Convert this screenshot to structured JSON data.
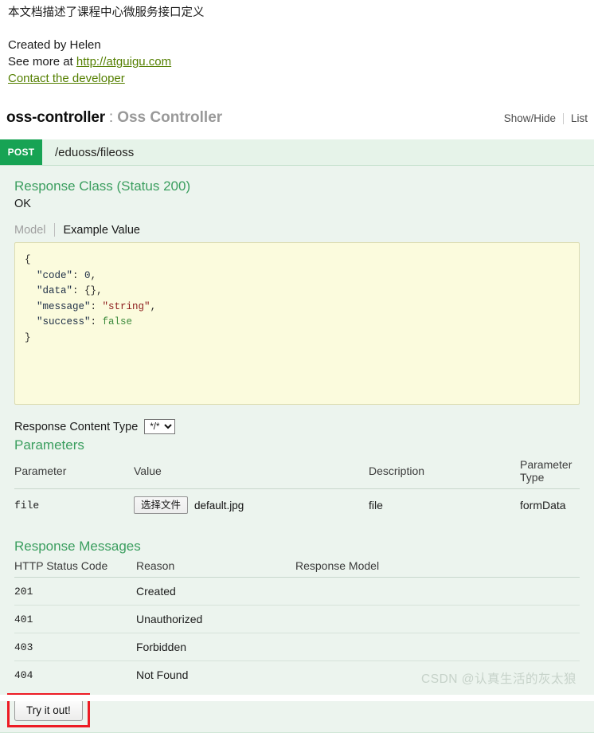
{
  "info": {
    "description": "本文档描述了课程中心微服务接口定义",
    "created_by": "Created by Helen",
    "see_more_prefix": "See more at ",
    "see_more_link": "http://atguigu.com",
    "contact_link": "Contact the developer"
  },
  "resource": {
    "name": "oss-controller",
    "separator": ":",
    "description": "Oss Controller",
    "show_hide": "Show/Hide",
    "list": "List"
  },
  "operation": {
    "method": "POST",
    "path": "/eduoss/fileoss"
  },
  "response_class": {
    "title": "Response Class (Status 200)",
    "status_text": "OK",
    "tab_model": "Model",
    "tab_example": "Example Value",
    "example_json": {
      "open_brace": "{",
      "lines": [
        {
          "key": "\"code\"",
          "value": "0",
          "type": "num",
          "comma": ","
        },
        {
          "key": "\"data\"",
          "value": "{}",
          "type": "punct",
          "comma": ","
        },
        {
          "key": "\"message\"",
          "value": "\"string\"",
          "type": "str",
          "comma": ","
        },
        {
          "key": "\"success\"",
          "value": "false",
          "type": "bool",
          "comma": ""
        }
      ],
      "close_brace": "}"
    }
  },
  "content_type": {
    "label": "Response Content Type",
    "selected": "*/*",
    "options": [
      "*/*"
    ]
  },
  "parameters": {
    "title": "Parameters",
    "headers": [
      "Parameter",
      "Value",
      "Description",
      "Parameter Type"
    ],
    "rows": [
      {
        "parameter": "file",
        "value_button": "选择文件",
        "value_filename": "default.jpg",
        "description": "file",
        "parameter_type": "formData"
      }
    ]
  },
  "response_messages": {
    "title": "Response Messages",
    "headers": [
      "HTTP Status Code",
      "Reason",
      "Response Model"
    ],
    "rows": [
      {
        "code": "201",
        "reason": "Created",
        "model": ""
      },
      {
        "code": "401",
        "reason": "Unauthorized",
        "model": ""
      },
      {
        "code": "403",
        "reason": "Forbidden",
        "model": ""
      },
      {
        "code": "404",
        "reason": "Not Found",
        "model": ""
      }
    ]
  },
  "submit": {
    "try_it_out": "Try it out!"
  },
  "watermark": {
    "text": "CSDN @认真生活的灰太狼"
  },
  "colors": {
    "method_post": "#17a354",
    "section_heading": "#3b9e5f",
    "panel_bg": "#ecf4ee",
    "panel_head_bg": "#e6f3e9",
    "code_bg": "#fbfbdd",
    "link": "#547f00",
    "annotation": "#ed1c24"
  }
}
